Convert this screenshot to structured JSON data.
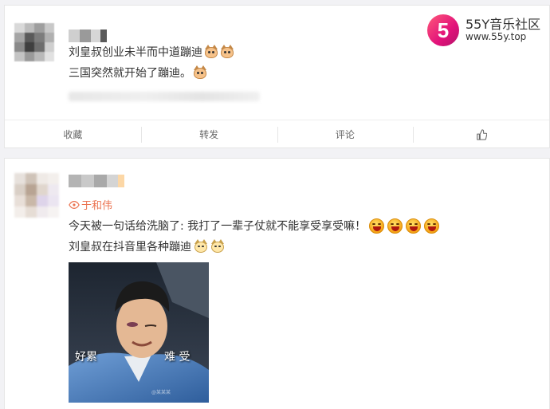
{
  "watermark_logo": {
    "glyph": "5",
    "title": "55Y音乐社区",
    "url": "www.55y.top"
  },
  "post1": {
    "line1": "刘皇叔创业未半而中道蹦迪",
    "line2": "三国突然就开始了蹦迪。",
    "line1_emojis": [
      "cat-emoji",
      "cat-emoji"
    ],
    "line2_emojis": [
      "cat-emoji"
    ],
    "actions": [
      {
        "label": "收藏",
        "icon": ""
      },
      {
        "label": "转发",
        "icon": ""
      },
      {
        "label": "评论",
        "icon": ""
      },
      {
        "label": "",
        "icon": "thumbs-up-icon"
      }
    ]
  },
  "post2": {
    "mention": "于和伟",
    "line1": "今天被一句话给洗脑了: 我打了一辈子仗就不能享受享受嘛！",
    "line1_emojis": [
      "laugh-emoji",
      "laugh-emoji",
      "laugh-emoji",
      "laugh-emoji"
    ],
    "line2": "刘皇叔在抖音里各种蹦迪",
    "line2_emojis": [
      "doge-emoji",
      "doge-emoji"
    ],
    "image": {
      "caption_left": "好累",
      "caption_right": "难 受",
      "watermark": "@某某某"
    }
  },
  "colors": {
    "accent_link": "#eb7350",
    "logo_gradient_start": "#ff5a7a",
    "logo_gradient_end": "#b3126a"
  }
}
